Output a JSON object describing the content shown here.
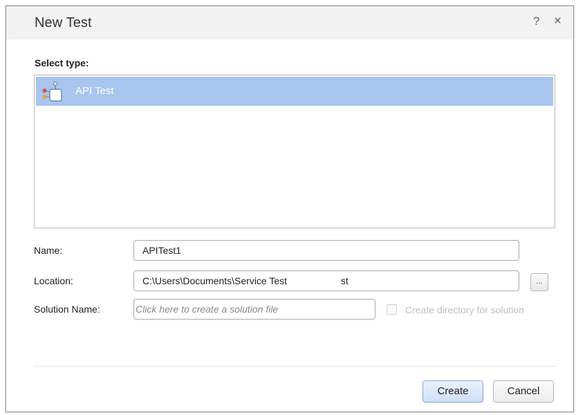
{
  "dialog": {
    "title": "New Test",
    "help_icon": "question-mark-icon",
    "close_icon": "close-icon",
    "help_glyph": "?",
    "close_glyph": "×"
  },
  "type_section": {
    "label": "Select type:",
    "items": [
      {
        "label": "API Test",
        "icon": "api-test-icon",
        "selected": true
      }
    ]
  },
  "form": {
    "name": {
      "label": "Name:",
      "value": "APITest1"
    },
    "location": {
      "label": "Location:",
      "value": "C:\\Users\\Documents\\Service Test                    st",
      "browse_label": "..."
    },
    "solution": {
      "label": "Solution Name:",
      "value": "",
      "placeholder": "Click here to create a solution file",
      "create_directory_label": "Create directory for solution",
      "create_directory_checked": false
    }
  },
  "buttons": {
    "create": "Create",
    "cancel": "Cancel"
  },
  "colors": {
    "selection": "#a8c6ee",
    "primary_border": "#7fa9e0",
    "disabled_text": "#c0c0c0"
  }
}
